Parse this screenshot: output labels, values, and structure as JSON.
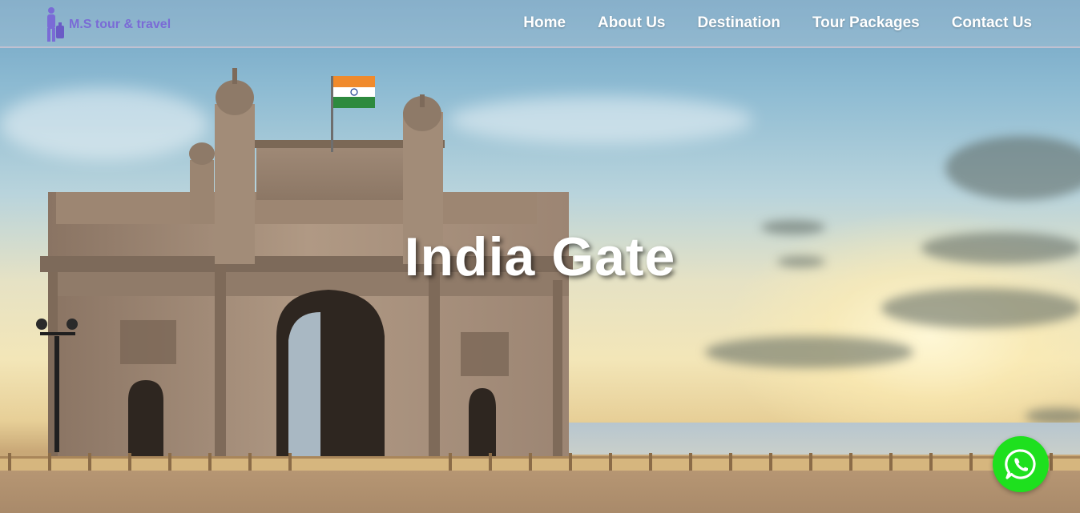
{
  "brand": {
    "name": "M.S tour & travel",
    "color": "#7a6bd6"
  },
  "nav": {
    "items": [
      {
        "label": "Home"
      },
      {
        "label": "About Us"
      },
      {
        "label": "Destination"
      },
      {
        "label": "Tour Packages"
      },
      {
        "label": "Contact Us"
      }
    ]
  },
  "hero": {
    "title": "India Gate"
  },
  "whatsapp": {
    "icon": "whatsapp-icon",
    "color": "#1ee01e"
  }
}
